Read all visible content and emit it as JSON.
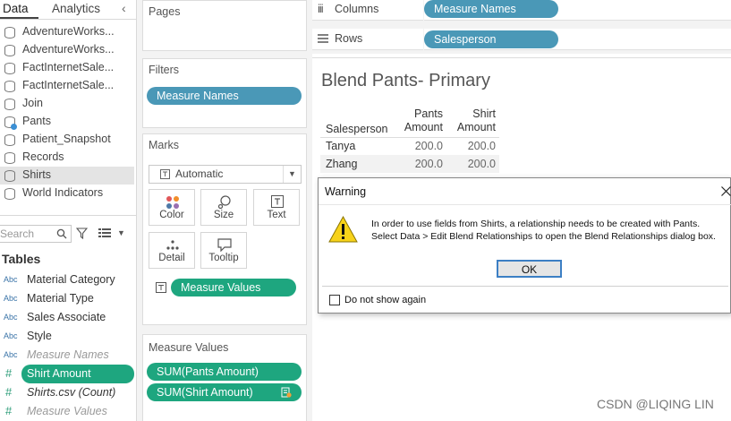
{
  "tabs": {
    "data": "Data",
    "analytics": "Analytics"
  },
  "data_sources": [
    "AdventureWorks...",
    "AdventureWorks...",
    "FactInternetSale...",
    "FactInternetSale...",
    "Join",
    "Pants",
    "Patient_Snapshot",
    "Records",
    "Shirts",
    "World Indicators"
  ],
  "search": {
    "placeholder": "Search"
  },
  "tables_header": "Tables",
  "fields": [
    {
      "type": "Abc",
      "label": "Material Category"
    },
    {
      "type": "Abc",
      "label": "Material Type"
    },
    {
      "type": "Abc",
      "label": "Sales Associate"
    },
    {
      "type": "Abc",
      "label": "Style"
    },
    {
      "type": "Abc",
      "label": "Measure Names"
    },
    {
      "type": "#",
      "label": "Shirt Amount"
    },
    {
      "type": "#",
      "label": "Shirts.csv (Count)"
    },
    {
      "type": "#",
      "label": "Measure Values"
    }
  ],
  "pages_card": {
    "title": "Pages"
  },
  "filters_card": {
    "title": "Filters",
    "pill": "Measure Names"
  },
  "marks_card": {
    "title": "Marks",
    "type": "Automatic",
    "buttons": {
      "color": "Color",
      "size": "Size",
      "text": "Text",
      "detail": "Detail",
      "tooltip": "Tooltip"
    },
    "pill": "Measure Values"
  },
  "measure_values_card": {
    "title": "Measure Values",
    "pills": [
      "SUM(Pants Amount)",
      "SUM(Shirt Amount)"
    ]
  },
  "shelves": {
    "columns_label": "Columns",
    "columns_pill": "Measure Names",
    "rows_label": "Rows",
    "rows_pill": "Salesperson"
  },
  "view": {
    "title": "Blend Pants- Primary",
    "row_header": "Salesperson",
    "col1_line1": "Pants",
    "col1_line2": "Amount",
    "col2_line1": "Shirt",
    "col2_line2": "Amount",
    "rows": [
      {
        "name": "Tanya",
        "pants": "200.0",
        "shirt": "200.0"
      },
      {
        "name": "Zhang",
        "pants": "200.0",
        "shirt": "200.0"
      }
    ]
  },
  "dialog": {
    "title": "Warning",
    "line1": "In order to use fields from Shirts, a relationship needs to be created with Pants.",
    "line2": "Select Data > Edit Blend Relationships to open the Blend Relationships dialog box.",
    "ok": "OK",
    "checkbox": "Do not show again"
  },
  "watermark": "CSDN @LIQING LIN"
}
